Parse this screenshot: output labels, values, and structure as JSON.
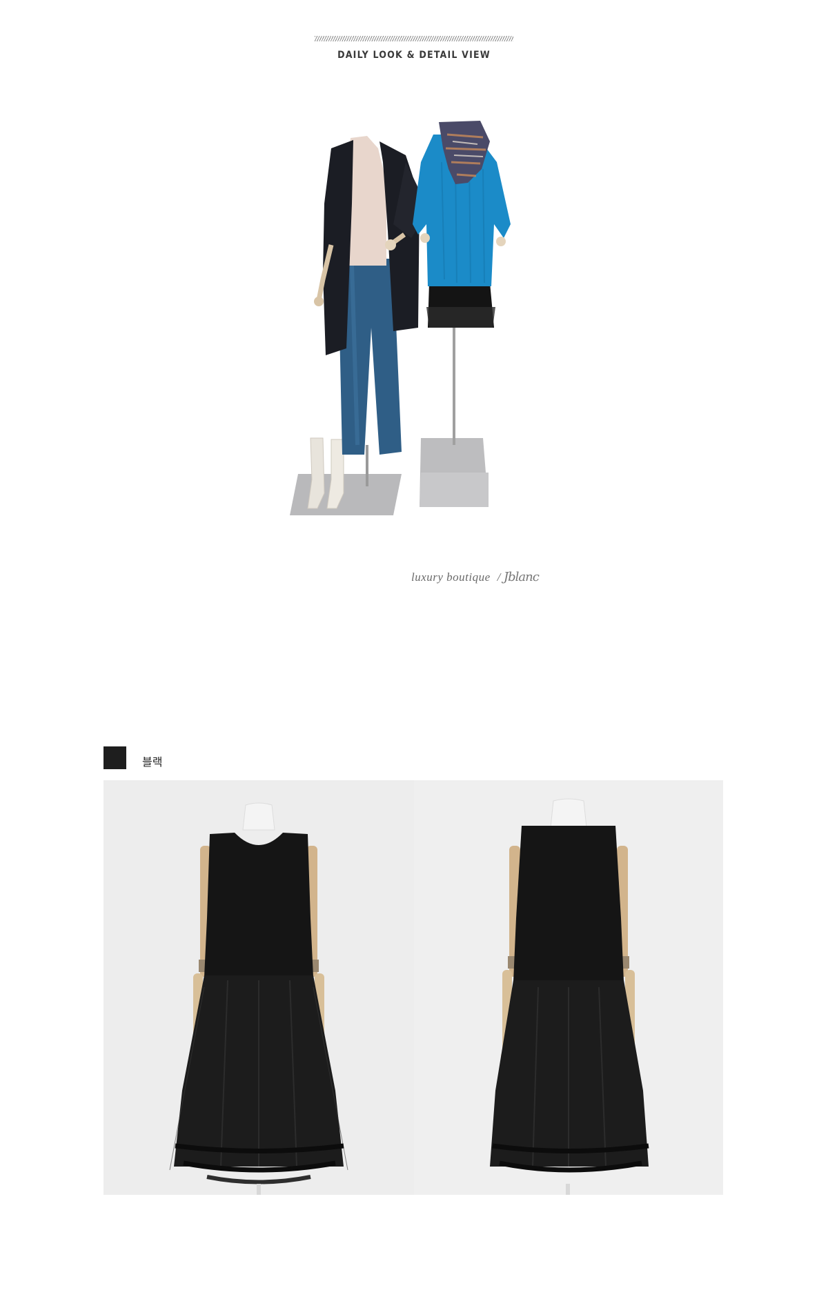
{
  "header": {
    "title": "DAILY LOOK & DETAIL VIEW"
  },
  "lookbook": {
    "caption_main": "luxury boutique",
    "caption_separator": "/",
    "caption_signature": "Jblanc"
  },
  "colors_section": {
    "swatch_color": "#1e1e1e",
    "label": "블랙"
  },
  "icons": [
    "hatch-divider",
    "color-swatch"
  ]
}
